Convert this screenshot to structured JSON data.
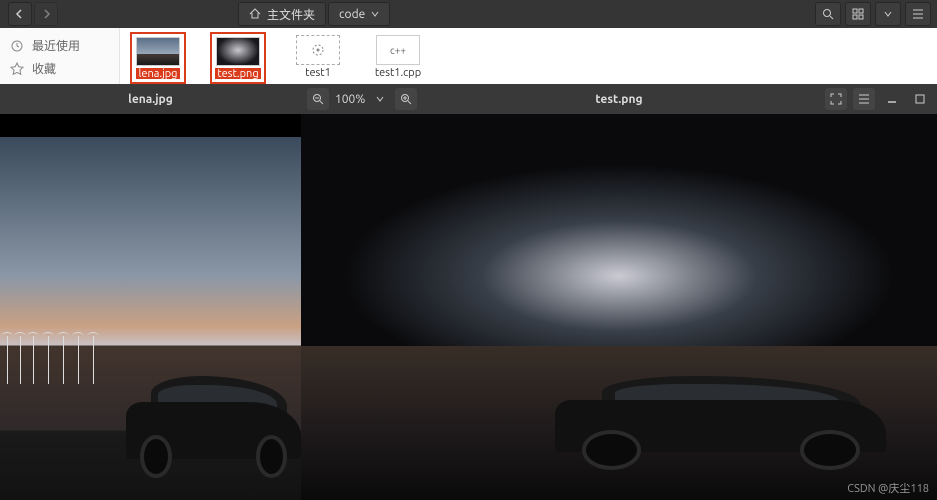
{
  "fm": {
    "path_home": "主文件夹",
    "path_current": "code",
    "sidebar": {
      "recent": "最近使用",
      "fav": "收藏"
    },
    "files": [
      {
        "name": "lena.jpg",
        "selected": true,
        "kind": "image-sky"
      },
      {
        "name": "test.png",
        "selected": true,
        "kind": "image-dark"
      },
      {
        "name": "test1",
        "selected": false,
        "kind": "exec"
      },
      {
        "name": "test1.cpp",
        "selected": false,
        "kind": "cpp"
      }
    ]
  },
  "viewer_left": {
    "title": "lena.jpg"
  },
  "viewer_right": {
    "title": "test.png",
    "zoom": "100%"
  },
  "watermark": "CSDN @庆尘118"
}
